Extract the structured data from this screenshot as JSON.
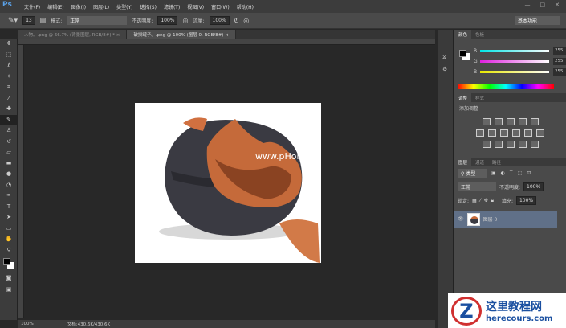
{
  "app": {
    "logo": "Ps"
  },
  "menu": [
    "文件(F)",
    "编辑(E)",
    "图像(I)",
    "图层(L)",
    "类型(Y)",
    "选择(S)",
    "滤镜(T)",
    "视图(V)",
    "窗口(W)",
    "帮助(H)"
  ],
  "window": {
    "minimize": "—",
    "maximize": "□",
    "close": "✕"
  },
  "options": {
    "brush_size": "13",
    "mode_label": "模式:",
    "mode_value": "正常",
    "opacity_label": "不透明度:",
    "opacity_value": "100%",
    "flow_label": "流量:",
    "flow_value": "100%",
    "workspace": "基本功能"
  },
  "tabs": [
    {
      "label": "人物。.png @ 66.7% (背景图层, RGB/8#) *",
      "close": "×"
    },
    {
      "label": "破损罐子。.png @ 100% (图层 0, RGB/8#)",
      "close": "×"
    }
  ],
  "canvas": {
    "watermark_text": "www.pHome.NET"
  },
  "status": {
    "zoom": "100%",
    "doc": "文档:430.6K/430.6K"
  },
  "color_panel": {
    "tabs": [
      "颜色",
      "色板"
    ],
    "channels": [
      {
        "name": "R",
        "value": "255",
        "color": "#00e5e5"
      },
      {
        "name": "G",
        "value": "255",
        "color": "#e020e0"
      },
      {
        "name": "B",
        "value": "255",
        "color": "#e8e800"
      }
    ]
  },
  "adjust_panel": {
    "tabs": [
      "调整",
      "样式"
    ],
    "title": "添加调整"
  },
  "layers_panel": {
    "tabs": [
      "图层",
      "通道",
      "路径"
    ],
    "filter": "类型",
    "blend": "正常",
    "opacity_label": "不透明度:",
    "opacity_value": "100%",
    "lock_label": "锁定:",
    "fill_label": "填充:",
    "fill_value": "100%",
    "layers": [
      {
        "name": "图层 0"
      }
    ]
  },
  "site_watermark": {
    "title": "这里教程网",
    "url": "herecours.com"
  }
}
